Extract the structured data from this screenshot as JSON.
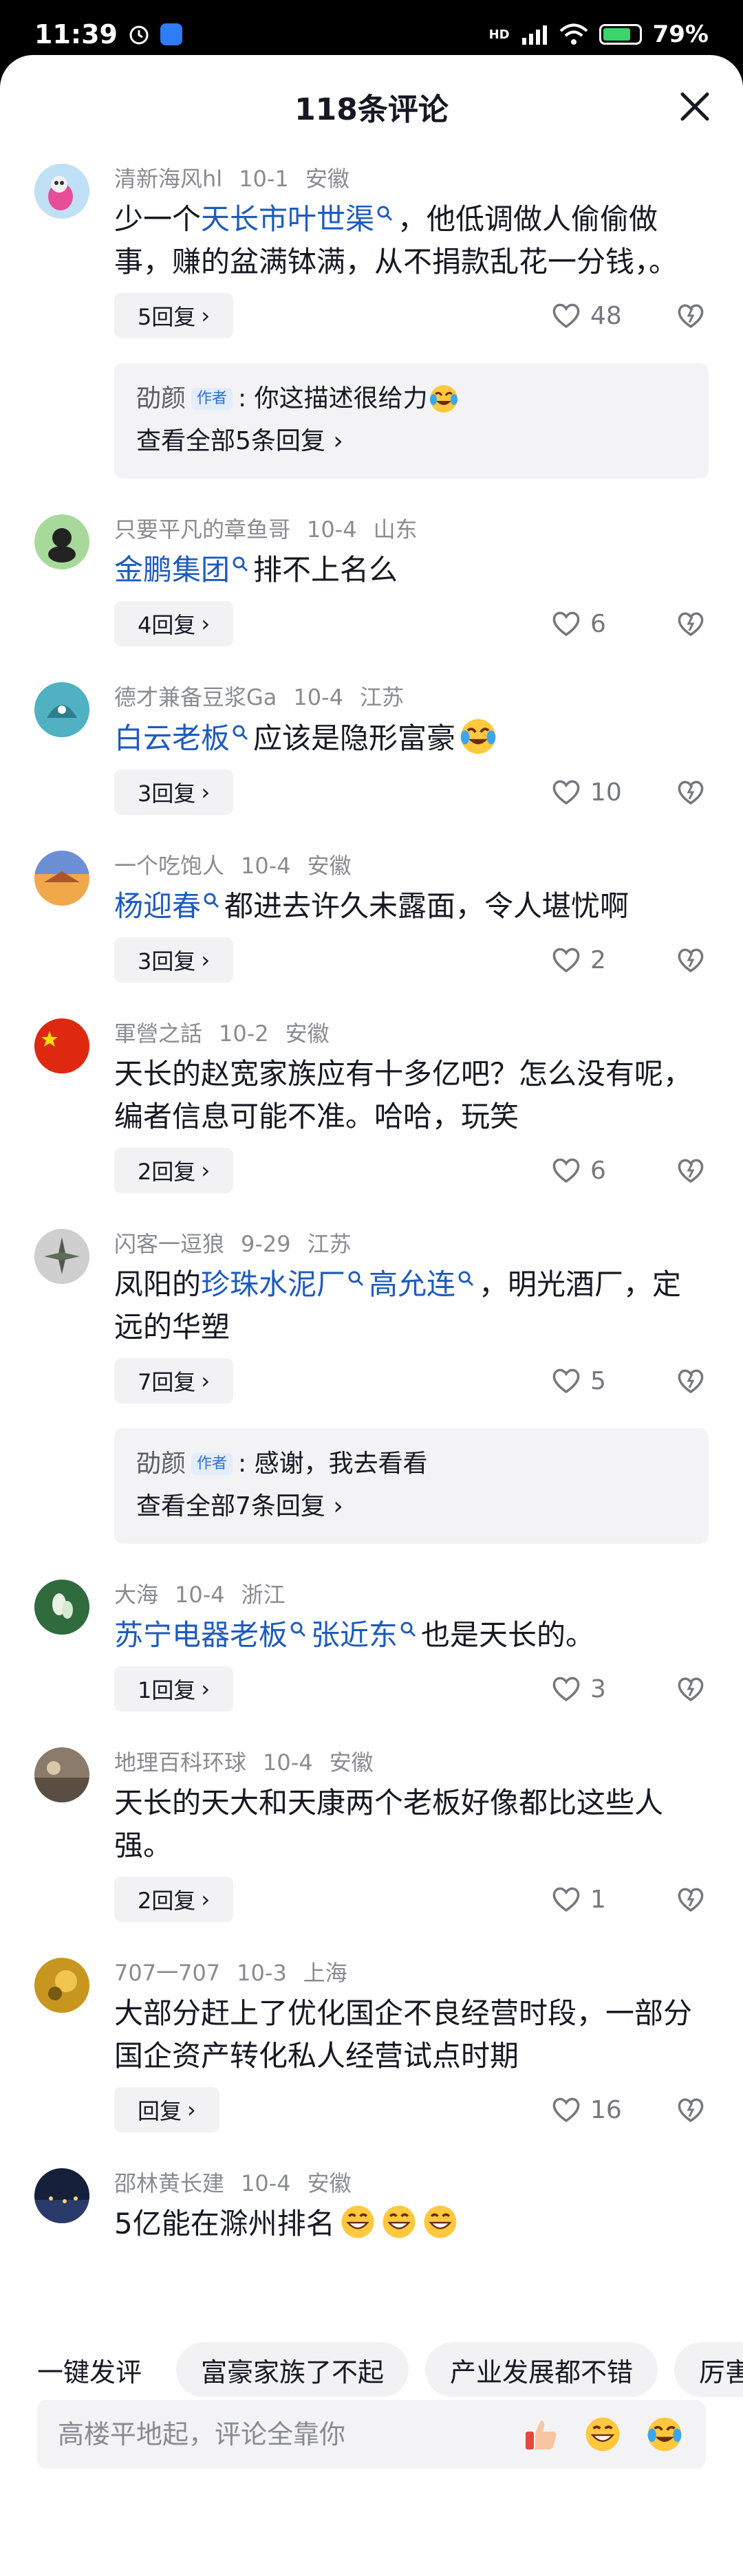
{
  "status_bar": {
    "time": "11:39",
    "battery": "79%",
    "network": "HD"
  },
  "header": {
    "title": "118条评论"
  },
  "comments": [
    {
      "user": "清新海风hl",
      "date": "10-1",
      "region": "安徽",
      "text_parts": [
        "少一个",
        "天长市叶世渠",
        "，他低调做人偷偷做事，赚的盆满钵满，从不捐款乱花一分钱，。"
      ],
      "reply": "5回复",
      "likes": "48",
      "author_reply": {
        "name": "劭颜",
        "tag": "作者",
        "text": ": 你这描述很给力",
        "more": "查看全部5条回复"
      }
    },
    {
      "user": "只要平凡的章鱼哥",
      "date": "10-4",
      "region": "山东",
      "text_parts": [
        "",
        "金鹏集团",
        "排不上名么"
      ],
      "reply": "4回复",
      "likes": "6"
    },
    {
      "user": "德才兼备豆浆Ga",
      "date": "10-4",
      "region": "江苏",
      "text_parts": [
        "",
        "白云老板",
        "应该是隐形富豪"
      ],
      "reply": "3回复",
      "likes": "10"
    },
    {
      "user": "一个吃饱人",
      "date": "10-4",
      "region": "安徽",
      "text_parts": [
        "",
        "杨迎春",
        "都进去许久未露面，令人堪忧啊"
      ],
      "reply": "3回复",
      "likes": "2"
    },
    {
      "user": "軍營之話",
      "date": "10-2",
      "region": "安徽",
      "text": "天长的赵宽家族应有十多亿吧？怎么没有呢，编者信息可能不准。哈哈，玩笑",
      "reply": "2回复",
      "likes": "6"
    },
    {
      "user": "闪客一逗狼",
      "date": "9-29",
      "region": "江苏",
      "text_parts": [
        "凤阳的",
        "珍珠水泥厂",
        "",
        "高允连",
        "，明光酒厂，定远的华塑"
      ],
      "reply": "7回复",
      "likes": "5",
      "author_reply": {
        "name": "劭颜",
        "tag": "作者",
        "text": ": 感谢，我去看看",
        "more": "查看全部7条回复"
      }
    },
    {
      "user": "大海",
      "date": "10-4",
      "region": "浙江",
      "text_parts": [
        "",
        "苏宁电器老板",
        "",
        "张近东",
        "也是天长的。"
      ],
      "reply": "1回复",
      "likes": "3"
    },
    {
      "user": "地理百科环球",
      "date": "10-4",
      "region": "安徽",
      "text": "天长的天大和天康两个老板好像都比这些人强。",
      "reply": "2回复",
      "likes": "1"
    },
    {
      "user": "707一707",
      "date": "10-3",
      "region": "上海",
      "text": "大部分赶上了优化国企不良经营时段，一部分国企资产转化私人经营试点时期",
      "reply": "回复",
      "likes": "16"
    },
    {
      "user": "邵林黄长建",
      "date": "10-4",
      "region": "安徽",
      "text": "5亿能在滁州排名"
    }
  ],
  "quick_comments": {
    "label": "一键发评",
    "chips": [
      "富豪家族了不起",
      "产业发展都不错",
      "厉害厉"
    ]
  },
  "input": {
    "placeholder": "高楼平地起，评论全靠你"
  },
  "colors": {
    "keyword": "#1d5bbf",
    "meta": "#8a8b91",
    "text": "#161823",
    "reply_bg": "#f2f2f4"
  }
}
